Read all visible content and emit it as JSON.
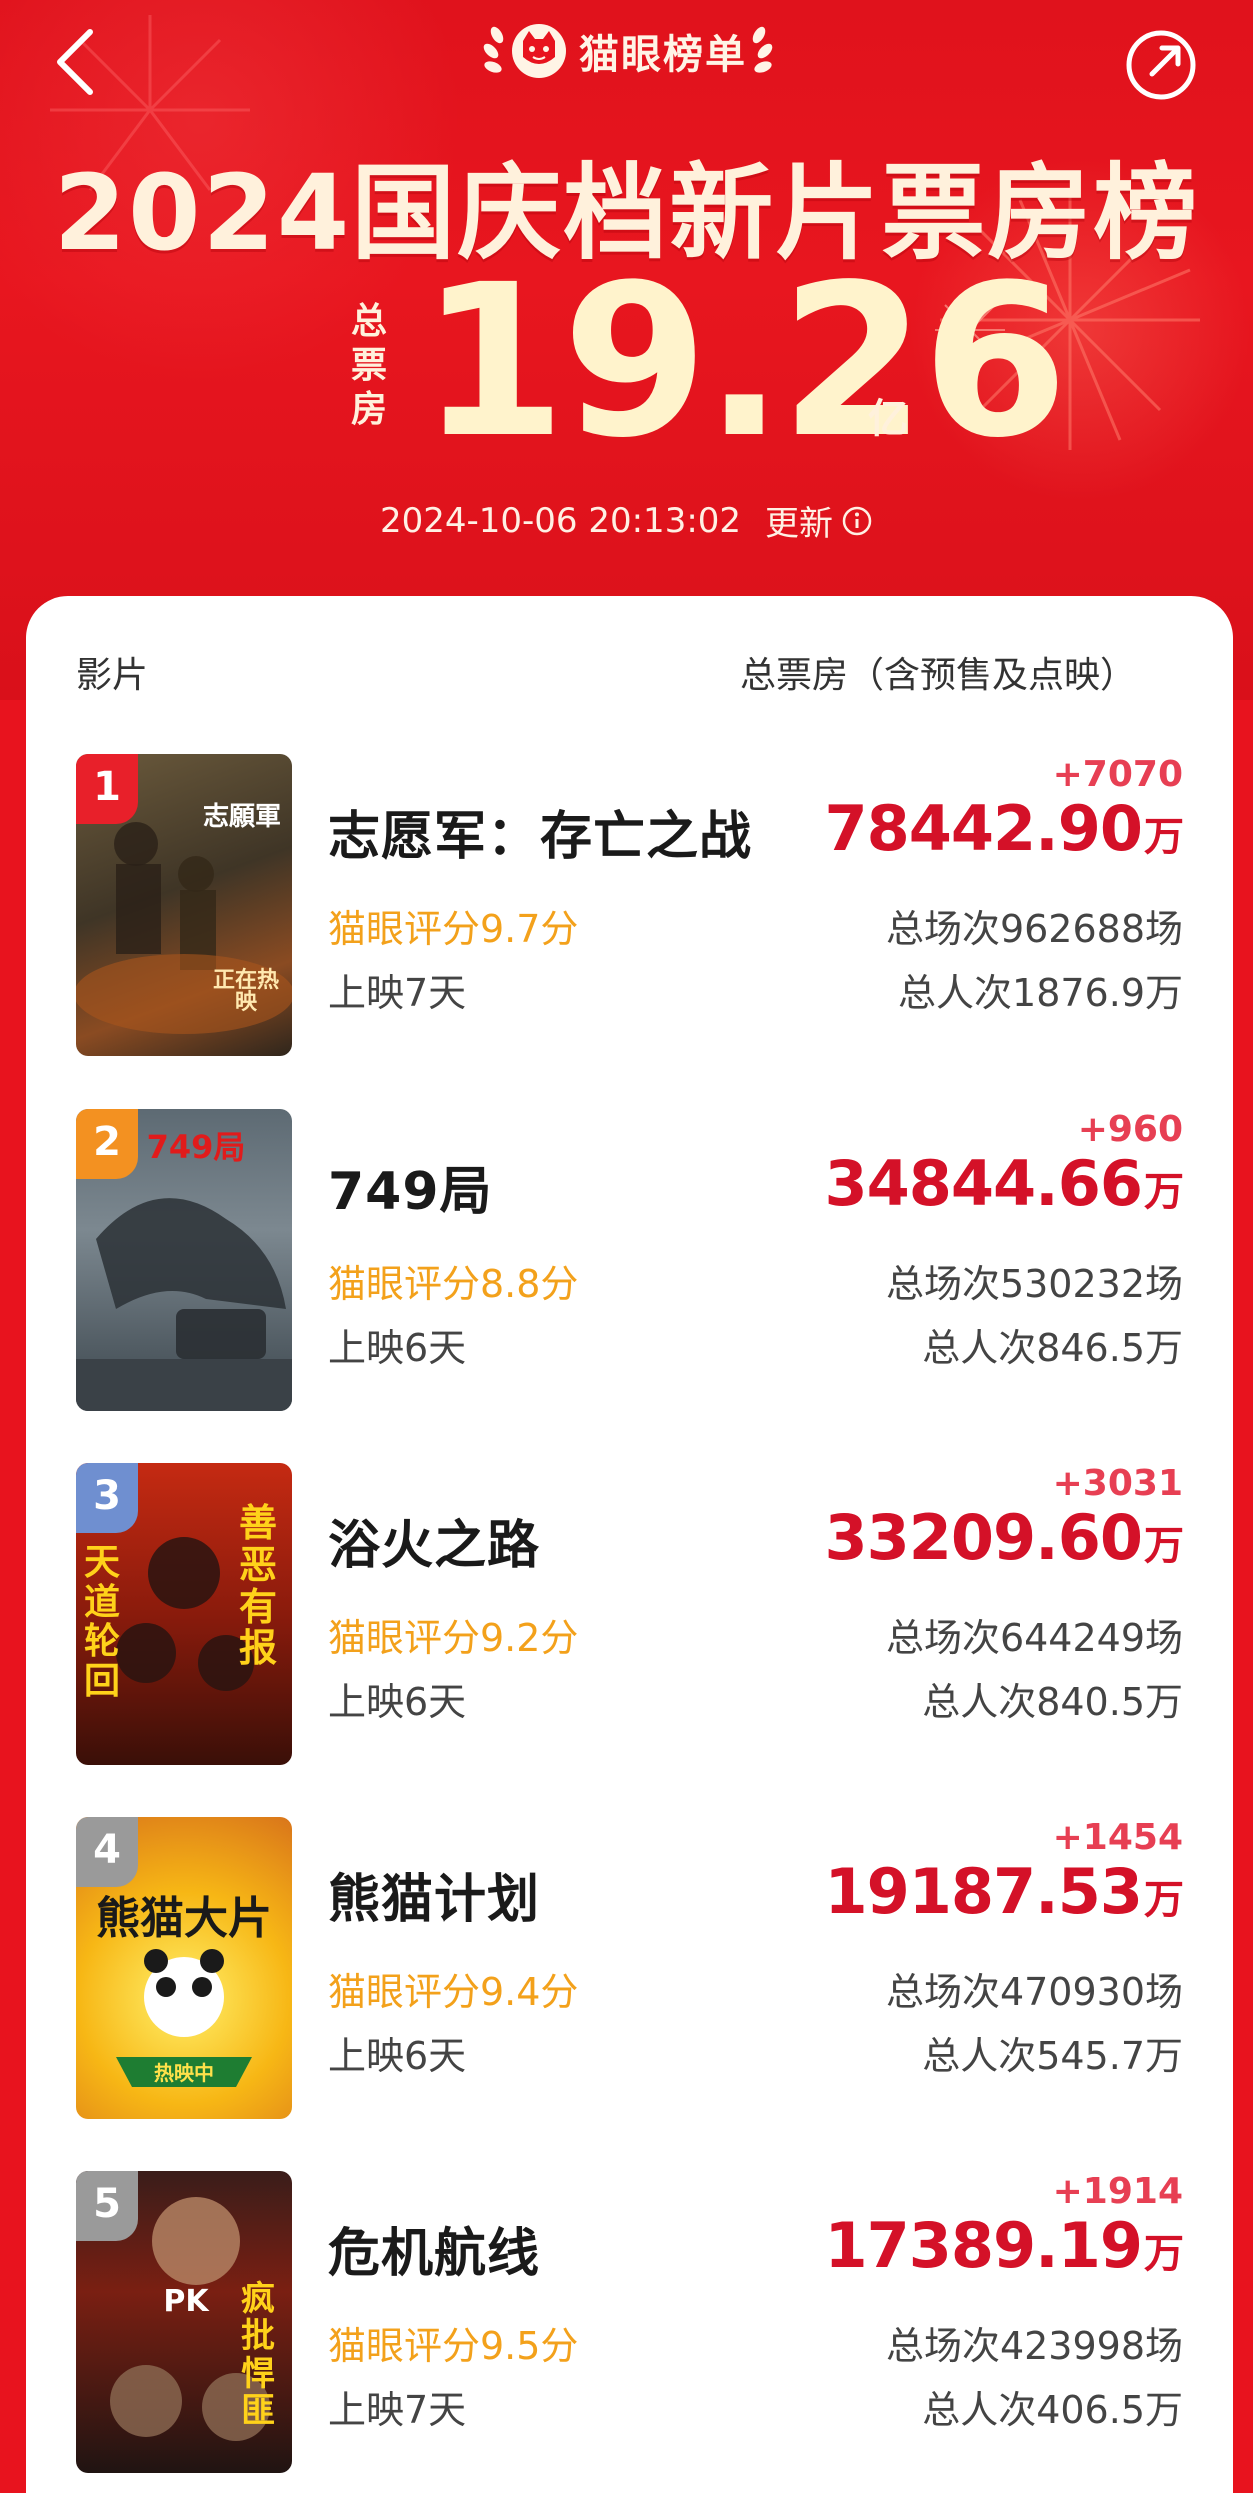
{
  "header": {
    "brand": "猫眼榜单",
    "title": "2024国庆档新片票房榜",
    "total_label": [
      "总",
      "票",
      "房"
    ],
    "total_value": "19.26",
    "total_unit": "亿",
    "update_time": "2024-10-06  20:13:02",
    "update_label": "更新"
  },
  "list": {
    "col_movie": "影片",
    "col_box": "总票房（含预售及点映）",
    "movies": [
      {
        "rank": "1",
        "rank_color": "#e8202a",
        "name": "志愿军：存亡之战",
        "score": "猫眼评分9.7分",
        "days": "上映7天",
        "delta": "+7070",
        "box": "78442.90",
        "unit": "万",
        "shows": "总场次962688场",
        "people": "总人次1876.9万",
        "poster_title": "志願軍",
        "poster_sub": "正在热映"
      },
      {
        "rank": "2",
        "rank_color": "#f39121",
        "name": "749局",
        "score": "猫眼评分8.8分",
        "days": "上映6天",
        "delta": "+960",
        "box": "34844.66",
        "unit": "万",
        "shows": "总场次530232场",
        "people": "总人次846.5万",
        "poster_title": "749局",
        "poster_sub": ""
      },
      {
        "rank": "3",
        "rank_color": "#6f8fd0",
        "name": "浴火之路",
        "score": "猫眼评分9.2分",
        "days": "上映6天",
        "delta": "+3031",
        "box": "33209.60",
        "unit": "万",
        "shows": "总场次644249场",
        "people": "总人次840.5万",
        "poster_title": "善恶有报",
        "poster_sub": "天道轮回"
      },
      {
        "rank": "4",
        "rank_color": "#9a9a9a",
        "name": "熊猫计划",
        "score": "猫眼评分9.4分",
        "days": "上映6天",
        "delta": "+1454",
        "box": "19187.53",
        "unit": "万",
        "shows": "总场次470930场",
        "people": "总人次545.7万",
        "poster_title": "熊猫大片",
        "poster_sub": "热映中"
      },
      {
        "rank": "5",
        "rank_color": "#9a9a9a",
        "name": "危机航线",
        "score": "猫眼评分9.5分",
        "days": "上映7天",
        "delta": "+1914",
        "box": "17389.19",
        "unit": "万",
        "shows": "总场次423998场",
        "people": "总人次406.5万",
        "poster_title": "疯批悍匪",
        "poster_sub": "PK"
      }
    ]
  },
  "colors": {
    "background_red": "#e8131e",
    "box_red": "#d41128",
    "delta_red": "#e73f53",
    "score_orange": "#f3a11b"
  },
  "icons": [
    "back-arrow-icon",
    "share-icon",
    "maoyan-cat-logo-icon",
    "laurel-left-icon",
    "laurel-right-icon",
    "info-icon"
  ]
}
